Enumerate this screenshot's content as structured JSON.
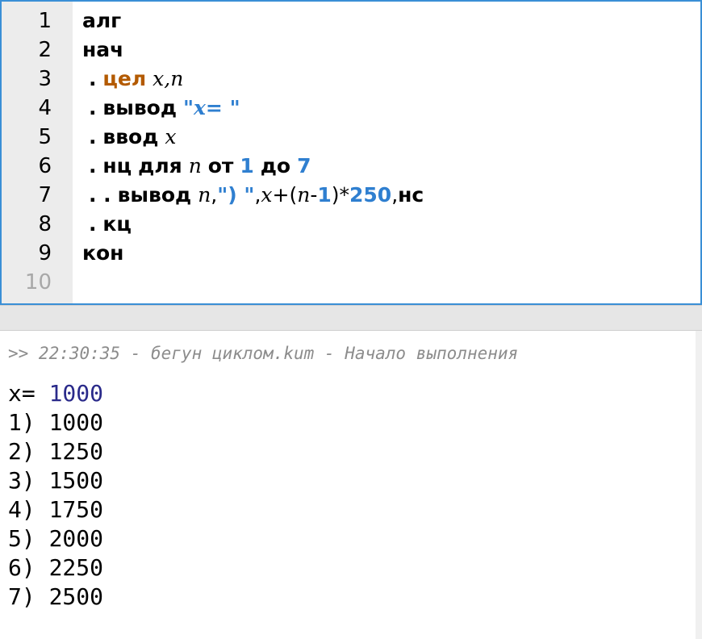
{
  "editor": {
    "line_numbers": [
      "1",
      "2",
      "3",
      "4",
      "5",
      "6",
      "7",
      "8",
      "9",
      "10"
    ],
    "lines": {
      "l1": {
        "kw": "алг"
      },
      "l2": {
        "kw": "нач"
      },
      "l3": {
        "dot": ".",
        "type": "цел",
        "vars": "x,n"
      },
      "l4": {
        "dot": ".",
        "kw": "вывод",
        "q1": "\"",
        "strv": "x",
        "strrest": "= ",
        "q2": "\""
      },
      "l5": {
        "dot": ".",
        "kw": "ввод",
        "var": "x"
      },
      "l6": {
        "dot": ".",
        "kw1": "нц",
        "kw2": "для",
        "var": "n",
        "kw3": "от",
        "n1": "1",
        "kw4": "до",
        "n2": "7"
      },
      "l7": {
        "dots": ". .",
        "kw": "вывод",
        "v1": "n",
        "c1": ",",
        "str": "\") \"",
        "c2": ",",
        "v2": "x",
        "plus": "+(",
        "v3": "n",
        "minus": "-",
        "n1": "1",
        "close": ")*",
        "n2": "250",
        "c3": ",",
        "kw2": "нс"
      },
      "l8": {
        "dot": ".",
        "kw": "кц"
      },
      "l9": {
        "kw": "кон"
      }
    }
  },
  "console": {
    "log": ">> 22:30:35 - бегун циклом.kum - Начало выполнения",
    "prompt": "x= ",
    "input_value": "1000",
    "output": [
      "1) 1000",
      "2) 1250",
      "3) 1500",
      "4) 1750",
      "5) 2000",
      "6) 2250",
      "7) 2500"
    ]
  },
  "colors": {
    "accent_border": "#3a8fd6",
    "keyword_type": "#b35a00",
    "literal": "#2f7fd0"
  }
}
